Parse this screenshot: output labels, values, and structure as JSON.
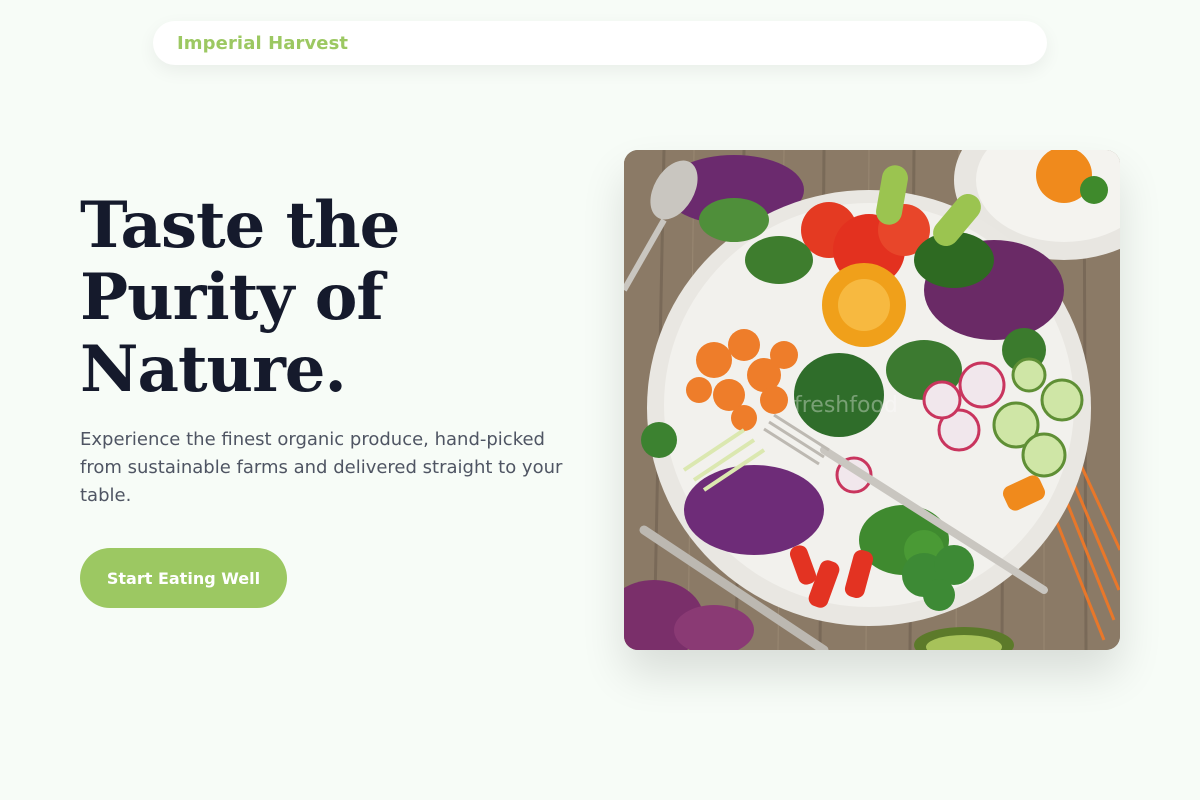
{
  "navbar": {
    "brand": "Imperial Harvest"
  },
  "hero": {
    "headline_line1": "Taste the",
    "headline_line2": "Purity of",
    "headline_line3": "Nature.",
    "description": "Experience the finest organic produce, hand-picked from sustainable farms and delivered straight to your table.",
    "cta_label": "Start Eating Well",
    "image_subject": "fresh vegetable salad bowl on wooden table",
    "image_watermark": "freshfood"
  },
  "colors": {
    "brand_green": "#9cc862",
    "headline": "#151a2c",
    "body_text": "#4f5563",
    "background": "#f7fcf7"
  }
}
